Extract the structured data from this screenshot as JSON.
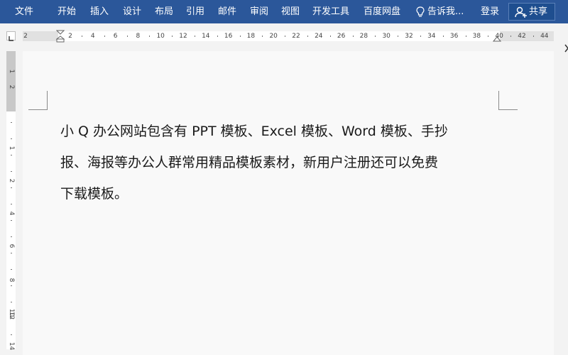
{
  "ribbon": {
    "tabs": [
      "文件",
      "开始",
      "插入",
      "设计",
      "布局",
      "引用",
      "邮件",
      "审阅",
      "视图",
      "开发工具",
      "百度网盘"
    ],
    "tell_me": "告诉我...",
    "login": "登录",
    "share": "共享"
  },
  "ruler": {
    "h_left": [
      "2"
    ],
    "h_right": [
      "2",
      "4",
      "6",
      "8",
      "10",
      "12",
      "14",
      "16",
      "18",
      "20",
      "22",
      "24",
      "26",
      "28",
      "30",
      "32",
      "34",
      "36",
      "38",
      "40",
      "42",
      "44"
    ],
    "v_labels": [
      "1",
      "2",
      "1",
      "2",
      "4",
      "6",
      "8",
      "10",
      "12",
      "14"
    ]
  },
  "document": {
    "lines": [
      " 小 Q 办公网站包含有 PPT 模板、Excel 模板、Word 模板、手抄",
      "报、海报等办公人群常用精品模板素材，新用户注册还可以免费",
      "下载模板。"
    ]
  },
  "colors": {
    "ribbon": "#2b579a",
    "page": "#f9f9f9",
    "ruler_margin": "#e1e1e1"
  }
}
